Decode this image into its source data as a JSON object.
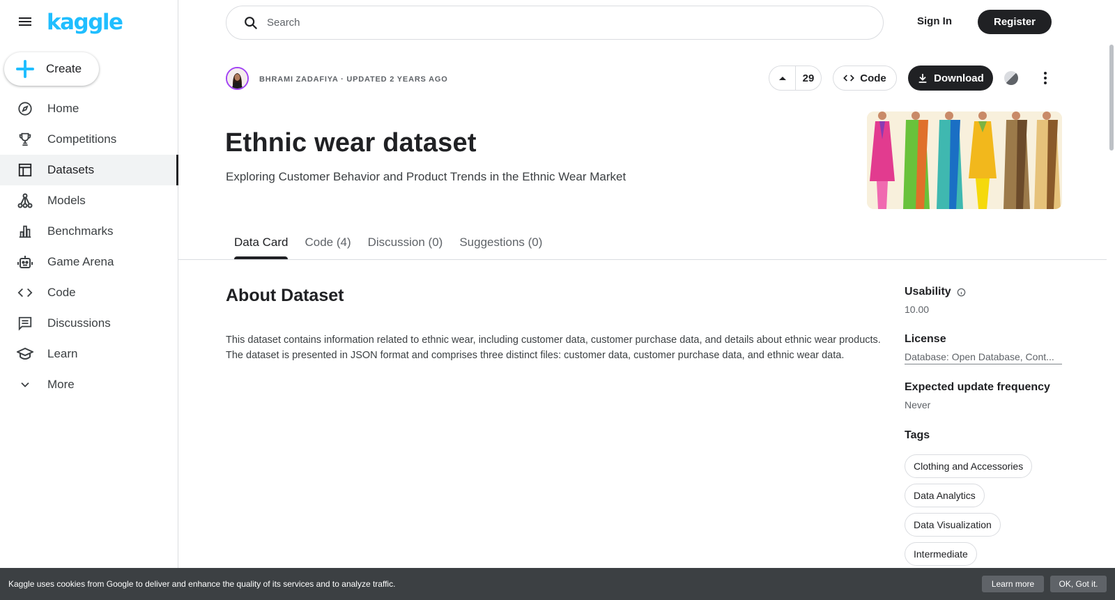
{
  "brand": {
    "logo_text": "kaggle",
    "accent": "#20beff"
  },
  "sidebar": {
    "create_label": "Create",
    "items": [
      {
        "label": "Home",
        "icon": "compass-icon"
      },
      {
        "label": "Competitions",
        "icon": "trophy-icon"
      },
      {
        "label": "Datasets",
        "icon": "table-icon",
        "active": true
      },
      {
        "label": "Models",
        "icon": "models-icon"
      },
      {
        "label": "Benchmarks",
        "icon": "bar-chart-icon"
      },
      {
        "label": "Game Arena",
        "icon": "robot-icon"
      },
      {
        "label": "Code",
        "icon": "code-icon"
      },
      {
        "label": "Discussions",
        "icon": "comment-icon"
      },
      {
        "label": "Learn",
        "icon": "graduation-cap-icon"
      },
      {
        "label": "More",
        "icon": "chevron-down-icon"
      }
    ]
  },
  "header": {
    "search_placeholder": "Search",
    "sign_in": "Sign In",
    "register": "Register"
  },
  "dataset": {
    "owner_line": "BHRAMI ZADAFIYA · UPDATED 2 YEARS AGO",
    "votes": "29",
    "code_label": "Code",
    "download_label": "Download",
    "title": "Ethnic wear dataset",
    "subtitle": "Exploring Customer Behavior and Product Trends in the Ethnic Wear Market"
  },
  "tabs": [
    {
      "label": "Data Card",
      "active": true
    },
    {
      "label": "Code (4)"
    },
    {
      "label": "Discussion (0)"
    },
    {
      "label": "Suggestions (0)"
    }
  ],
  "about": {
    "heading": "About Dataset",
    "text": "This dataset contains information related to ethnic wear, including customer data, customer purchase data, and details about ethnic wear products. The dataset is presented in JSON format and comprises three distinct files: customer data, customer purchase data, and ethnic wear data."
  },
  "side_panel": {
    "usability_label": "Usability",
    "usability_value": "10.00",
    "license_label": "License",
    "license_value": "Database: Open Database, Cont...",
    "frequency_label": "Expected update frequency",
    "frequency_value": "Never",
    "tags_label": "Tags",
    "tags": [
      "Clothing and Accessories",
      "Data Analytics",
      "Data Visualization",
      "Intermediate"
    ]
  },
  "cookie_banner": {
    "text": "Kaggle uses cookies from Google to deliver and enhance the quality of its services and to analyze traffic.",
    "learn_more": "Learn more",
    "ok": "OK, Got it."
  }
}
